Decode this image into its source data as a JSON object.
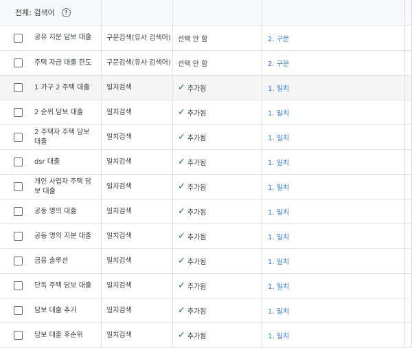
{
  "header": {
    "col_keyword": "전체: 검색어",
    "help_icon": "help-circle-icon"
  },
  "rows": [
    {
      "keyword": "공유 지분 담보 대출",
      "match": "구문검색(유사 검색어)",
      "status": "선택 안 함",
      "added": false,
      "level": "2. 구문"
    },
    {
      "keyword": "주택 자금 대출 한도",
      "match": "구문검색(유사 검색어)",
      "status": "선택 안 함",
      "added": false,
      "level": "2. 구문"
    },
    {
      "keyword": "1 가구 2 주택 대출",
      "match": "일치검색",
      "status": "추가됨",
      "added": true,
      "level": "1. 일치"
    },
    {
      "keyword": "2 순위 담보 대출",
      "match": "일치검색",
      "status": "추가됨",
      "added": true,
      "level": "1. 일치"
    },
    {
      "keyword": "2 주택자 주택 담보 대출",
      "match": "일치검색",
      "status": "추가됨",
      "added": true,
      "level": "1. 일치"
    },
    {
      "keyword": "dsr 대출",
      "match": "일치검색",
      "status": "추가됨",
      "added": true,
      "level": "1. 일치"
    },
    {
      "keyword": "개인 사업자 주택 담보 대출",
      "match": "일치검색",
      "status": "추가됨",
      "added": true,
      "level": "1. 일치"
    },
    {
      "keyword": "공동 명의 대출",
      "match": "일치검색",
      "status": "추가됨",
      "added": true,
      "level": "1. 일치"
    },
    {
      "keyword": "공동 명의 지분 대출",
      "match": "일치검색",
      "status": "추가됨",
      "added": true,
      "level": "1. 일치"
    },
    {
      "keyword": "금융 솔루션",
      "match": "일치검색",
      "status": "추가됨",
      "added": true,
      "level": "1. 일치"
    },
    {
      "keyword": "단독 주택 담보 대출",
      "match": "일치검색",
      "status": "추가됨",
      "added": true,
      "level": "1. 일치"
    },
    {
      "keyword": "담보 대출 추가",
      "match": "일치검색",
      "status": "추가됨",
      "added": true,
      "level": "1. 일치"
    },
    {
      "keyword": "담보 대출 후순위",
      "match": "일치검색",
      "status": "추가됨",
      "added": true,
      "level": "1. 일치"
    }
  ],
  "check_glyph": "✓"
}
